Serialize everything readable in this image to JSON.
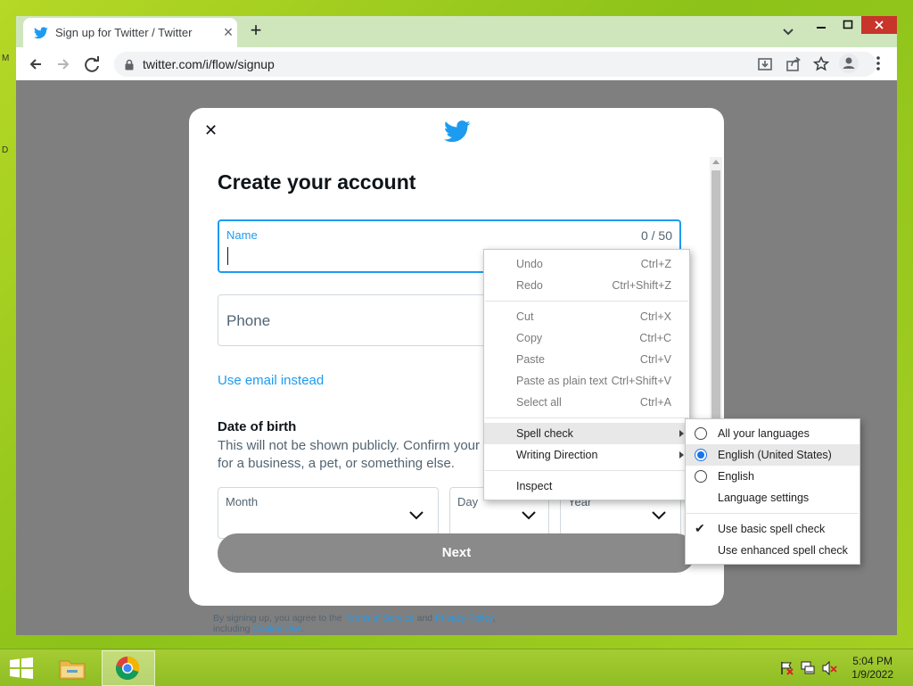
{
  "browser": {
    "tab_title": "Sign up for Twitter / Twitter",
    "tab_close": "×",
    "new_tab": "+",
    "url": "twitter.com/i/flow/signup"
  },
  "desktop": {
    "frag_top": "M",
    "frag_mid": "D"
  },
  "modal": {
    "close": "✕",
    "heading": "Create your account",
    "name_label": "Name",
    "name_count": "0 / 50",
    "phone_placeholder": "Phone",
    "use_email": "Use email instead",
    "dob_title": "Date of birth",
    "dob_desc": "This will not be shown publicly. Confirm your own age, even if this account is for a business, a pet, or something else.",
    "month_label": "Month",
    "day_label": "Day",
    "year_label": "Year",
    "next": "Next"
  },
  "legal": {
    "part1": "By signing up, you agree to the ",
    "terms": "Terms of Service",
    "and": " and ",
    "privacy": "Privacy Policy",
    "part2": ", including ",
    "cookie": "Cookie Use",
    "end": "."
  },
  "context_menu": {
    "items": [
      {
        "label": "Undo",
        "shortcut": "Ctrl+Z"
      },
      {
        "label": "Redo",
        "shortcut": "Ctrl+Shift+Z"
      },
      {
        "label": "Cut",
        "shortcut": "Ctrl+X"
      },
      {
        "label": "Copy",
        "shortcut": "Ctrl+C"
      },
      {
        "label": "Paste",
        "shortcut": "Ctrl+V"
      },
      {
        "label": "Paste as plain text",
        "shortcut": "Ctrl+Shift+V"
      },
      {
        "label": "Select all",
        "shortcut": "Ctrl+A"
      },
      {
        "label": "Spell check"
      },
      {
        "label": "Writing Direction"
      },
      {
        "label": "Inspect"
      }
    ]
  },
  "spell_submenu": {
    "items": [
      {
        "label": "All your languages",
        "selected": false
      },
      {
        "label": "English (United States)",
        "selected": true
      },
      {
        "label": "English",
        "selected": false
      },
      {
        "label": "Language settings"
      },
      {
        "label": "Use basic spell check",
        "checked": true
      },
      {
        "label": "Use enhanced spell check"
      }
    ]
  },
  "taskbar": {
    "time": "5:04 PM",
    "date": "1/9/2022"
  },
  "colors": {
    "accent": "#1d9bf0",
    "desktop": "#9ccb1f",
    "next_disabled": "#8a8a8a"
  }
}
